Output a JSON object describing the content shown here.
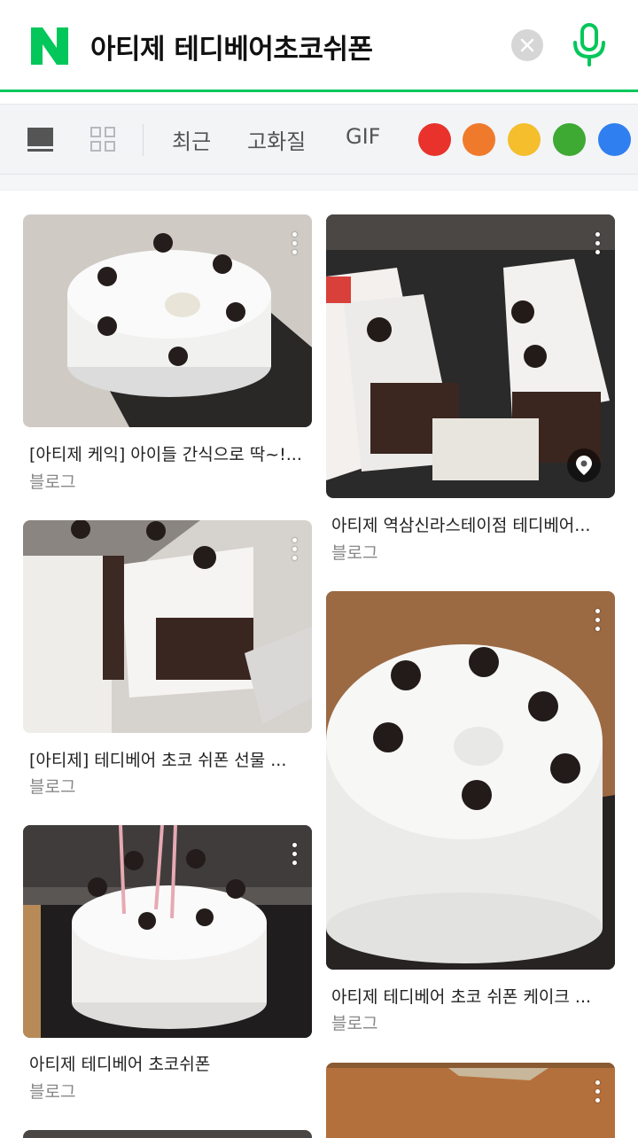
{
  "search": {
    "query": "아티제 테디베어초코쉬폰"
  },
  "brand": {
    "logo_letter": "N",
    "accent": "#03c75a"
  },
  "icons": {
    "logo": "naver-n-logo",
    "clear": "close-icon",
    "mic": "microphone-icon",
    "single_view": "single-view-icon",
    "grid_view": "grid-view-icon",
    "more": "more-vertical-icon",
    "location": "location-pin-icon"
  },
  "filters": {
    "options": [
      "최근",
      "고화질",
      "GIF"
    ],
    "colors": [
      "#e8322b",
      "#f07a2c",
      "#f4be2c",
      "#3ea933",
      "#2f7ff0"
    ]
  },
  "results": [
    {
      "title": "[아티제 케익] 아이들 간식으로 딱~!...",
      "source": "블로그"
    },
    {
      "title": "아티제 역삼신라스테이점 테디베어...",
      "source": "블로그"
    },
    {
      "title": "[아티제] 테디베어 초코 쉬폰 선물 ...",
      "source": "블로그"
    },
    {
      "title": "아티제 테디베어 초코 쉬폰 케이크 ...",
      "source": "블로그"
    },
    {
      "title": "아티제 테디베어 초코쉬폰",
      "source": "블로그"
    }
  ]
}
